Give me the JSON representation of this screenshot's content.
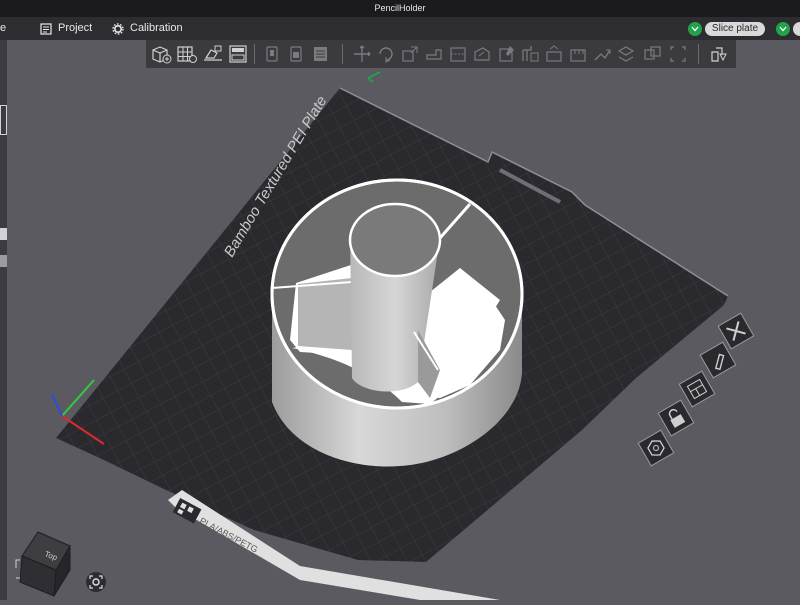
{
  "window": {
    "title": "PencilHolder"
  },
  "menubar": {
    "edge_label": "e",
    "project_label": "Project",
    "calibration_label": "Calibration",
    "slice_label": "Slice plate"
  },
  "plate": {
    "name": "Bamboo Textured PEI Plate",
    "filament_label": "PLA/ABS/PETG"
  },
  "navcube": {
    "face_label": "Top"
  },
  "colors": {
    "titlebar": "#1b1b1d",
    "menubar": "#2d2d31",
    "toolbar": "#3a3a3f",
    "viewport": "#5a5a60",
    "plate": "#2a2a2e",
    "grid": "#3c3c41",
    "accent": "#22a24a",
    "model": "#d4d4d4"
  },
  "toolbar_icons": [
    "add-object-icon",
    "arrange-grid-icon",
    "auto-orient-icon",
    "split-layout-icon",
    "copy-icon",
    "paste-icon",
    "list-icon",
    "move-icon",
    "rotate-icon",
    "scale-icon",
    "flatten-icon",
    "cut-icon",
    "support-paint-icon",
    "seam-paint-icon",
    "color-paint-icon",
    "text-icon",
    "measure-icon",
    "assembly-icon",
    "explode-icon"
  ]
}
